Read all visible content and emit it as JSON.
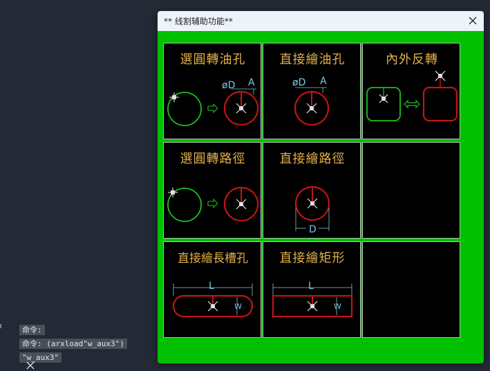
{
  "window": {
    "title": "**  线割辅助功能**",
    "close_icon": "close-icon"
  },
  "command_line": [
    "命令:",
    "命令: (arxload\"w_aux3\")",
    "\"w_aux3\""
  ],
  "buttons": [
    {
      "label": "選圓轉油孔",
      "dim_d": "øD",
      "dim_a": "A"
    },
    {
      "label": "直接繪油孔",
      "dim_d": "øD",
      "dim_a": "A"
    },
    {
      "label": "內外反轉"
    },
    {
      "label": "選圓轉路徑"
    },
    {
      "label": "直接繪路徑",
      "dim_d": "D"
    },
    {
      "label": ""
    },
    {
      "label": "直接繪長槽孔",
      "dim_l": "L",
      "dim_w": "W"
    },
    {
      "label": "直接繪矩形",
      "dim_l": "L",
      "dim_w": "W"
    },
    {
      "label": ""
    }
  ],
  "colors": {
    "dialog_bg": "#00c000",
    "label": "#e2b04a",
    "circle_green": "#1fc01f",
    "circle_red": "#c41414",
    "dim": "#7ec8e3",
    "arrow": "#1fc01f"
  }
}
